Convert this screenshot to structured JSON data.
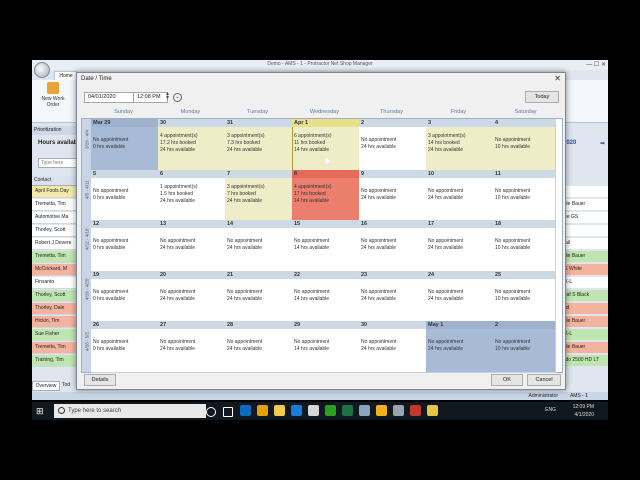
{
  "app": {
    "title": "Demo - AMS - 1 - Protractor Net Shop Manager",
    "home_tab": "Home",
    "new_work_order": "New Work Order",
    "prioritization_tab": "Prioritization",
    "hours_label": "Hours available",
    "search_placeholder": "Type here",
    "contact_header": "Contact",
    "contacts": [
      {
        "name": "April Fools Day",
        "color": "#f3e9a8"
      },
      {
        "name": "Tremetta, Tim",
        "color": "#ffffff"
      },
      {
        "name": "Automotive Ma",
        "color": "#ffffff"
      },
      {
        "name": "Thorley, Scott",
        "color": "#ffffff"
      },
      {
        "name": "Robert J Devere",
        "color": "#ffffff"
      },
      {
        "name": "Tremetta, Tim",
        "color": "#bfe6b0"
      },
      {
        "name": "McCrickard, M",
        "color": "#f4b39e"
      },
      {
        "name": "Finsanto",
        "color": "#ffffff"
      },
      {
        "name": "Thorley, Scott",
        "color": "#bfe6b0"
      },
      {
        "name": "Thorley, Dale",
        "color": "#f4b39e"
      },
      {
        "name": "Hickin, Tim",
        "color": "#f4b39e"
      },
      {
        "name": "Sue Fisher",
        "color": "#bfe6b0"
      },
      {
        "name": "Tremetta, Tim",
        "color": "#f4b39e"
      },
      {
        "name": "Training, Tim",
        "color": "#bfe6b0"
      }
    ],
    "right_date": "1/2020",
    "right_items": [
      {
        "text": "",
        "color": "#ffffff"
      },
      {
        "text": "ddie Bauer",
        "color": "#ffffff"
      },
      {
        "text": "tree GS",
        "color": "#ffffff"
      },
      {
        "text": "",
        "color": "#ffffff"
      },
      {
        "text": "mali",
        "color": "#ffffff"
      },
      {
        "text": "ddie Bauer",
        "color": "#bfe6b0"
      },
      {
        "text": "SE White",
        "color": "#f4b39e"
      },
      {
        "text": "EX-L",
        "color": "#ffffff"
      },
      {
        "text": "Leaf S Black",
        "color": "#bfe6b0"
      },
      {
        "text": "brid",
        "color": "#f4b39e"
      },
      {
        "text": "ddie Bauer",
        "color": "#f4b39e"
      },
      {
        "text": "EX-L",
        "color": "#bfe6b0"
      },
      {
        "text": "ddie Bauer",
        "color": "#f4b39e"
      },
      {
        "text": "rado 2500 HD LT",
        "color": "#bfe6b0"
      }
    ],
    "overview_tab": "Overview",
    "tab2": "Tod",
    "status_user": "Administrator",
    "status_ams": "AMS - 1"
  },
  "dialog": {
    "title": "Date / Time",
    "date_value": "04/01/2020",
    "time_value": "12:08 PM",
    "today_label": "Today",
    "details_label": "Details",
    "ok_label": "OK",
    "cancel_label": "Cancel",
    "day_headers": [
      "Sunday",
      "Monday",
      "Tuesday",
      "Wednesday",
      "Thursday",
      "Friday",
      "Saturday"
    ],
    "weeks": [
      {
        "label": "3/29 - 4/4",
        "days": [
          {
            "day": "Mar 29",
            "state": "past",
            "lines": [
              "No appointment",
              "0 hrs available"
            ]
          },
          {
            "day": "30",
            "state": "partial",
            "lines": [
              "4 appointment(s)",
              "17.2 hrs booked",
              "24 hrs available"
            ]
          },
          {
            "day": "31",
            "state": "partial",
            "lines": [
              "3 appointment(s)",
              "7.3 hrs booked",
              "24 hrs available"
            ]
          },
          {
            "day": "Apr 1",
            "state": "partial sel",
            "lines": [
              "6 appointment(s)",
              "11 hrs booked",
              "14 hrs available"
            ]
          },
          {
            "day": "2",
            "state": "normal",
            "lines": [
              "No appointment",
              "24 hrs available"
            ]
          },
          {
            "day": "3",
            "state": "partial",
            "lines": [
              "3 appointment(s)",
              "14 hrs booked",
              "24 hrs available"
            ]
          },
          {
            "day": "4",
            "state": "partial",
            "lines": [
              "No appointment",
              "10 hrs available"
            ]
          }
        ]
      },
      {
        "label": "4/5 - 4/11",
        "days": [
          {
            "day": "5",
            "state": "normal",
            "lines": [
              "No appointment",
              "0 hrs available"
            ]
          },
          {
            "day": "6",
            "state": "normal",
            "lines": [
              "1 appointment(s)",
              "1.5 hrs booked",
              "24 hrs available"
            ]
          },
          {
            "day": "7",
            "state": "partial",
            "lines": [
              "3 appointment(s)",
              "7 hrs booked",
              "24 hrs available"
            ]
          },
          {
            "day": "8",
            "state": "full",
            "lines": [
              "4 appointment(s)",
              "17 hrs booked",
              "14 hrs available"
            ]
          },
          {
            "day": "9",
            "state": "normal",
            "lines": [
              "No appointment",
              "24 hrs available"
            ]
          },
          {
            "day": "10",
            "state": "normal",
            "lines": [
              "No appointment",
              "24 hrs available"
            ]
          },
          {
            "day": "11",
            "state": "normal",
            "lines": [
              "No appointment",
              "10 hrs available"
            ]
          }
        ]
      },
      {
        "label": "4/12 - 4/18",
        "days": [
          {
            "day": "12",
            "state": "normal",
            "lines": [
              "No appointment",
              "0 hrs available"
            ]
          },
          {
            "day": "13",
            "state": "normal",
            "lines": [
              "No appointment",
              "24 hrs available"
            ]
          },
          {
            "day": "14",
            "state": "normal",
            "lines": [
              "No appointment",
              "24 hrs available"
            ]
          },
          {
            "day": "15",
            "state": "normal",
            "lines": [
              "No appointment",
              "14 hrs available"
            ]
          },
          {
            "day": "16",
            "state": "normal",
            "lines": [
              "No appointment",
              "24 hrs available"
            ]
          },
          {
            "day": "17",
            "state": "normal",
            "lines": [
              "No appointment",
              "24 hrs available"
            ]
          },
          {
            "day": "18",
            "state": "normal",
            "lines": [
              "No appointment",
              "10 hrs available"
            ]
          }
        ]
      },
      {
        "label": "4/19 - 4/25",
        "days": [
          {
            "day": "19",
            "state": "normal",
            "lines": [
              "No appointment",
              "0 hrs available"
            ]
          },
          {
            "day": "20",
            "state": "normal",
            "lines": [
              "No appointment",
              "24 hrs available"
            ]
          },
          {
            "day": "21",
            "state": "normal",
            "lines": [
              "No appointment",
              "24 hrs available"
            ]
          },
          {
            "day": "22",
            "state": "normal",
            "lines": [
              "No appointment",
              "14 hrs available"
            ]
          },
          {
            "day": "23",
            "state": "normal",
            "lines": [
              "No appointment",
              "24 hrs available"
            ]
          },
          {
            "day": "24",
            "state": "normal",
            "lines": [
              "No appointment",
              "24 hrs available"
            ]
          },
          {
            "day": "25",
            "state": "normal",
            "lines": [
              "No appointment",
              "10 hrs available"
            ]
          }
        ]
      },
      {
        "label": "4/26 - 5/2",
        "days": [
          {
            "day": "26",
            "state": "normal",
            "lines": [
              "No appointment",
              "0 hrs available"
            ]
          },
          {
            "day": "27",
            "state": "normal",
            "lines": [
              "No appointment",
              "24 hrs available"
            ]
          },
          {
            "day": "28",
            "state": "normal",
            "lines": [
              "No appointment",
              "24 hrs available"
            ]
          },
          {
            "day": "29",
            "state": "normal",
            "lines": [
              "No appointment",
              "14 hrs available"
            ]
          },
          {
            "day": "30",
            "state": "normal",
            "lines": [
              "No appointment",
              "24 hrs available"
            ]
          },
          {
            "day": "May 1",
            "state": "past",
            "lines": [
              "No appointment",
              "24 hrs available"
            ]
          },
          {
            "day": "2",
            "state": "past",
            "lines": [
              "No appointment",
              "10 hrs available"
            ]
          }
        ]
      }
    ]
  },
  "taskbar": {
    "search_placeholder": "Type here to search",
    "language": "ENG",
    "time": "12:09 PM",
    "date": "4/1/2020",
    "icons": [
      {
        "name": "cortana-icon",
        "color": "#ffffff"
      },
      {
        "name": "task-view-icon",
        "color": "#ffffff"
      },
      {
        "name": "outlook-icon",
        "color": "#0f6cbd"
      },
      {
        "name": "chrome-icon",
        "color": "#e0a10a"
      },
      {
        "name": "file-explorer-icon",
        "color": "#f2c94c"
      },
      {
        "name": "edge-icon",
        "color": "#1d7bd8"
      },
      {
        "name": "paint-icon",
        "color": "#d6d6d6"
      },
      {
        "name": "quickbooks-icon",
        "color": "#2ca01c"
      },
      {
        "name": "excel-icon",
        "color": "#1e7145"
      },
      {
        "name": "tools-icon",
        "color": "#8aa4bf"
      },
      {
        "name": "chrome-canary-icon",
        "color": "#f2b21b"
      },
      {
        "name": "document-icon",
        "color": "#9aa3b0"
      },
      {
        "name": "app-icon",
        "color": "#c0392b"
      },
      {
        "name": "protractor-icon",
        "color": "#e6c545"
      }
    ]
  }
}
